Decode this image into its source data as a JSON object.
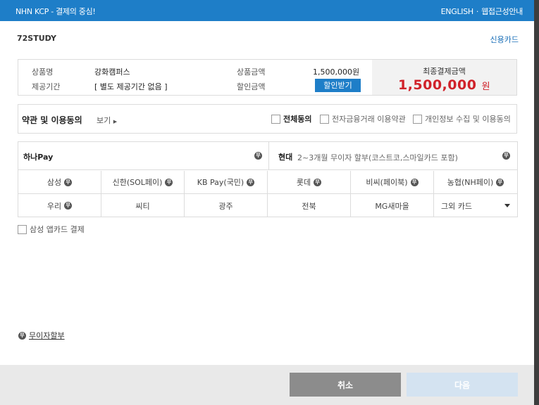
{
  "header": {
    "brand": "NHN KCP - 결제의 중심!",
    "english": "ENGLISH",
    "separator": "·",
    "accessibility": "웹접근성안내"
  },
  "merchant": {
    "name": "72STUDY",
    "pay_type": "신용카드"
  },
  "summary": {
    "product_label": "상품명",
    "product_value": "강화캠퍼스",
    "period_label": "제공기간",
    "period_value": "[ 별도 제공기간 없음 ]",
    "price_label": "상품금액",
    "price_value": "1,500,000원",
    "discount_label": "할인금액",
    "discount_button": "할인받기",
    "final_title": "최종결제금액",
    "final_amount": "1,500,000",
    "final_unit": "원"
  },
  "terms": {
    "title": "약관 및 이용동의",
    "view": "보기",
    "agree_all": "전체동의",
    "agree_ecommerce": "전자금융거래 이용약관",
    "agree_privacy": "개인정보 수집 및 이용동의"
  },
  "cards": {
    "badge": "무",
    "hana": "하나Pay",
    "hyundai": "현대",
    "hyundai_desc": "2~3개월 무이자 할부(코스트코,스마일카드 포함)",
    "row1": [
      "삼성",
      "신한(SOL페이)",
      "KB Pay(국민)",
      "롯데",
      "비씨(페이북)",
      "농협(NH페이)"
    ],
    "row2": [
      "우리",
      "씨티",
      "광주",
      "전북",
      "MG새마을"
    ],
    "other": "그외 카드"
  },
  "app_card": "삼성 앱카드 결제",
  "installment_link": "무이자할부",
  "footer": {
    "cancel": "취소",
    "next": "다음"
  },
  "colors": {
    "header": "#1e7ec8",
    "amount": "#d0222a",
    "accent": "#1a6fb8"
  }
}
